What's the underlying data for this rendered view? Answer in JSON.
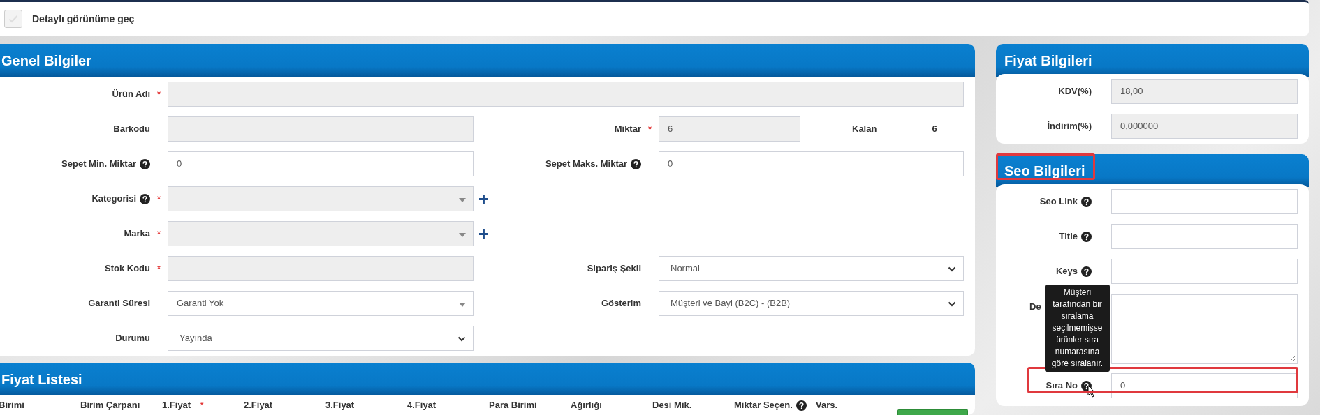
{
  "view_toggle": {
    "label": "Detaylı görünüme geç",
    "checked": false
  },
  "general": {
    "title": "Genel Bilgiler",
    "rows": [
      {
        "left": {
          "label": "Ürün Adı",
          "required_mark": "*",
          "help": false,
          "kind": "input",
          "disabled": true,
          "full_width": true
        }
      },
      {
        "left": {
          "label": "Barkodu",
          "help": false,
          "kind": "input",
          "disabled": true
        },
        "right": {
          "label": "Miktar",
          "required_mark": "*",
          "help": false,
          "kind": "input",
          "disabled": true,
          "value": "6",
          "short": true,
          "extra_label": "Kalan",
          "extra_value": "6"
        }
      },
      {
        "left": {
          "label": "Sepet Min. Miktar",
          "help": true,
          "kind": "input",
          "disabled": false,
          "value": "0"
        },
        "right": {
          "label": "Sepet Maks. Miktar",
          "help": true,
          "kind": "input",
          "disabled": false,
          "value": "0"
        }
      },
      {
        "left": {
          "label": "Kategorisi",
          "required_mark": "*",
          "help": true,
          "kind": "select2",
          "disabled": true,
          "add": true
        }
      },
      {
        "left": {
          "label": "Marka",
          "required_mark": "*",
          "help": false,
          "kind": "select2",
          "disabled": true,
          "add": true
        }
      },
      {
        "left": {
          "label": "Stok Kodu",
          "required_mark": "*",
          "help": false,
          "kind": "input",
          "disabled": true
        },
        "right": {
          "label": "Sipariş Şekli",
          "help": false,
          "kind": "select",
          "disabled": false,
          "value": "Normal"
        }
      },
      {
        "left": {
          "label": "Garanti Süresi",
          "help": false,
          "kind": "select2",
          "disabled": false,
          "value": "Garanti Yok"
        },
        "right": {
          "label": "Gösterim",
          "help": false,
          "kind": "select",
          "disabled": false,
          "value": "Müşteri ve Bayi (B2C) - (B2B)"
        }
      },
      {
        "left": {
          "label": "Durumu",
          "help": false,
          "kind": "select",
          "disabled": false,
          "value": "Yayında"
        }
      }
    ]
  },
  "price_list": {
    "title": "Fiyat Listesi",
    "columns": [
      {
        "label": "Birimi",
        "help": false
      },
      {
        "label": "Birim Çarpanı",
        "help": false
      },
      {
        "label": "1.Fiyat",
        "required_mark": "*",
        "help": false
      },
      {
        "label": "2.Fiyat",
        "help": false
      },
      {
        "label": "3.Fiyat",
        "help": false
      },
      {
        "label": "4.Fiyat",
        "help": false
      },
      {
        "label": "Para Birimi",
        "help": false
      },
      {
        "label": "Ağırlığı",
        "help": false
      },
      {
        "label": "Desi Mik.",
        "help": false
      },
      {
        "label": "Miktar Seçen.",
        "help": true
      },
      {
        "label": "Vars.",
        "help": false
      }
    ]
  },
  "price_info": {
    "title": "Fiyat Bilgileri",
    "highlighted": false,
    "fields": [
      {
        "label": "KDV(%)",
        "help": false,
        "kind": "input",
        "disabled": true,
        "value": "18,00",
        "highlighted": false
      },
      {
        "label": "İndirim(%)",
        "help": false,
        "kind": "input",
        "disabled": true,
        "value": "0,000000",
        "highlighted": false
      }
    ]
  },
  "seo_info": {
    "title": "Seo Bilgileri",
    "highlighted": true,
    "fields": [
      {
        "label": "Seo Link",
        "help": true,
        "kind": "input",
        "disabled": false,
        "highlighted": false
      },
      {
        "label": "Title",
        "help": true,
        "kind": "input",
        "disabled": false,
        "highlighted": false
      },
      {
        "label": "Keys",
        "help": true,
        "kind": "input",
        "disabled": false,
        "highlighted": false
      },
      {
        "label": "De",
        "help": false,
        "kind": "textarea",
        "disabled": false,
        "highlighted": false
      },
      {
        "label": "Sıra No",
        "help": true,
        "kind": "input",
        "disabled": false,
        "value": "0",
        "highlighted": true,
        "cursor": true
      }
    ],
    "tooltip": "Müşteri tarafından bir sıralama seçilmemişse ürünler sıra numarasına göre sıralanır."
  }
}
